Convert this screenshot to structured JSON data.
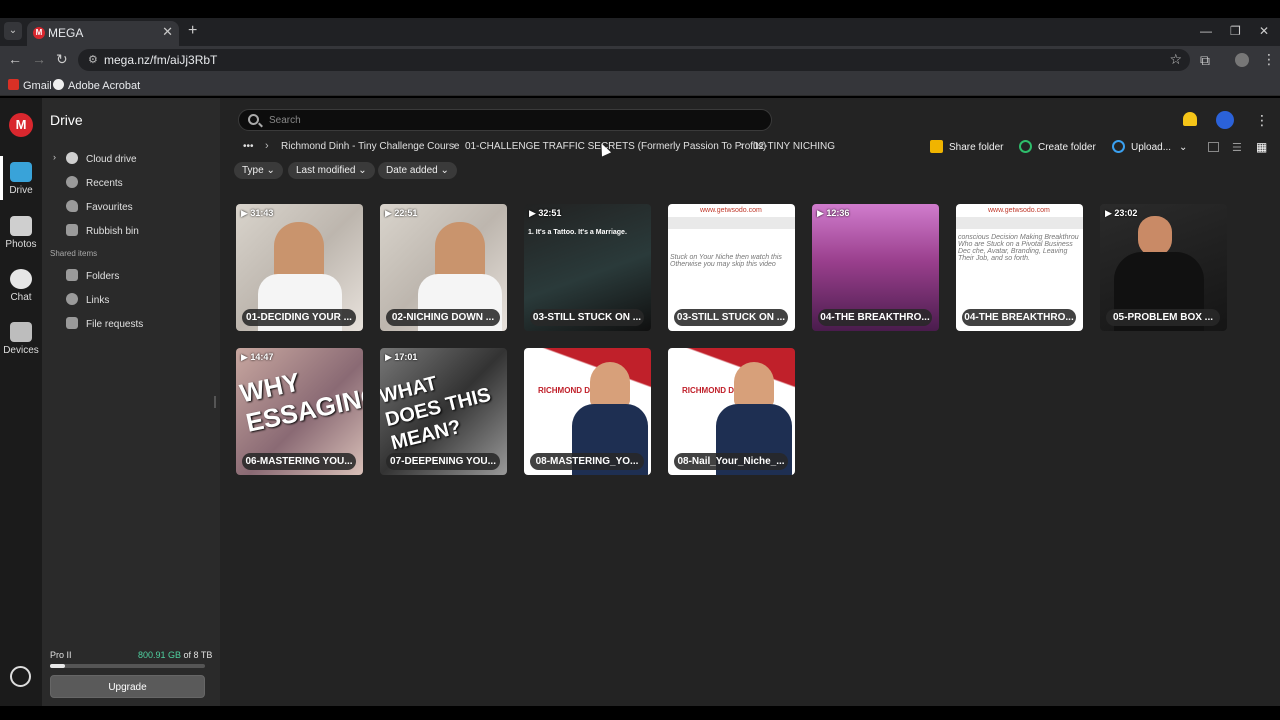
{
  "browser": {
    "tab_title": "MEGA",
    "url": "mega.nz/fm/aiJj3RbT",
    "bookmarks": [
      "Gmail",
      "Adobe Acrobat"
    ]
  },
  "rail": {
    "items": [
      {
        "label": "Drive"
      },
      {
        "label": "Photos"
      },
      {
        "label": "Chat"
      },
      {
        "label": "Devices"
      }
    ]
  },
  "sidebar": {
    "title": "Drive",
    "items": [
      "Cloud drive",
      "Recents",
      "Favourites",
      "Rubbish bin"
    ],
    "shared_header": "Shared items",
    "shared_items": [
      "Folders",
      "Links",
      "File requests"
    ],
    "plan": "Pro II",
    "storage_used": "800.91 GB",
    "storage_total": " of 8 TB",
    "storage_fraction": 0.098,
    "upgrade_label": "Upgrade"
  },
  "search": {
    "placeholder": "Search"
  },
  "breadcrumb": {
    "more": "•••",
    "items": [
      "Richmond Dinh - Tiny Challenge Course",
      "01-CHALLENGE TRAFFIC SECRETS (Formerly Passion To Profits)",
      "02-TINY NICHING"
    ]
  },
  "actions": {
    "share": "Share folder",
    "create": "Create folder",
    "upload": "Upload..."
  },
  "filters": [
    "Type",
    "Last modified",
    "Date added"
  ],
  "files": [
    {
      "duration": "31:43",
      "name": "01-DECIDING YOUR ..."
    },
    {
      "duration": "22:51",
      "name": "02-NICHING DOWN ..."
    },
    {
      "duration": "32:51",
      "name": "03-STILL STUCK ON ...",
      "overlay": "1. It's a Tattoo. It's a Marriage."
    },
    {
      "duration": "",
      "name": "03-STILL STUCK ON ...",
      "header": "www.getwsodo.com",
      "overlay": "Stuck on Your Niche then watch this Otherwise you may skip this video"
    },
    {
      "duration": "12:36",
      "name": "04-THE BREAKTHRO..."
    },
    {
      "duration": "",
      "name": "04-THE BREAKTHRO...",
      "header": "www.getwsodo.com",
      "overlay": "conscious Decision Making Breakthrou Who are Stuck on a Pivotal Business Dec che, Avatar, Branding, Leaving Their Job, and so forth."
    },
    {
      "duration": "23:02",
      "name": "05-PROBLEM BOX ..."
    },
    {
      "duration": "14:47",
      "name": "06-MASTERING YOU...",
      "overlay": "WHY ESSAGING"
    },
    {
      "duration": "17:01",
      "name": "07-DEEPENING YOU...",
      "overlay": "WHAT DOES THIS MEAN?"
    },
    {
      "duration": "",
      "name": "08-MASTERING_YO...",
      "overlay": "RICHMOND DINH"
    },
    {
      "duration": "",
      "name": "08-Nail_Your_Niche_...",
      "overlay": "RICHMOND DINH"
    }
  ],
  "colors": {
    "accent": "#d9272e",
    "storage_used": "#4fd1a0",
    "background": "#232323"
  }
}
